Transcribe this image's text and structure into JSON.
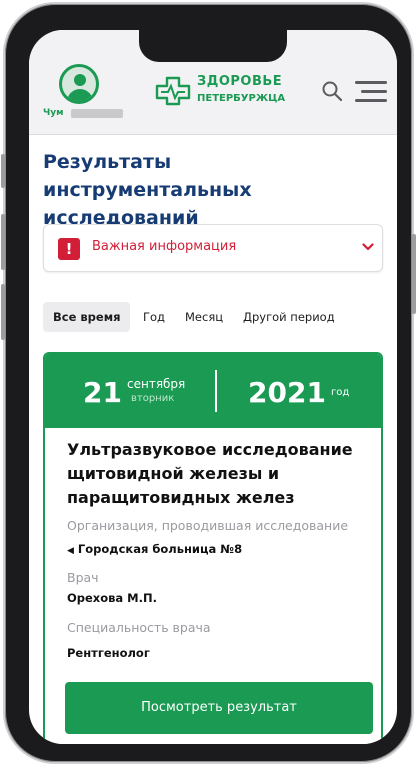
{
  "header": {
    "user_name": "Чум",
    "logo_line1": "ЗДОРОВЬЕ",
    "logo_line2": "ПЕТЕРБУРЖЦА"
  },
  "page": {
    "title": "Результаты инструментальных исследований"
  },
  "alert": {
    "label": "Важная информация",
    "mark": "!"
  },
  "period_tabs": [
    {
      "label": "Все время",
      "active": true
    },
    {
      "label": "Год",
      "active": false
    },
    {
      "label": "Месяц",
      "active": false
    },
    {
      "label": "Другой период",
      "active": false
    }
  ],
  "record": {
    "day": "21",
    "month": "сентября",
    "weekday": "вторник",
    "year": "2021",
    "year_label": "год",
    "study_title": "Ультразвуковое исследование щитовидной железы и паращитовидных желез",
    "org_label": "Организация, проводившая исследование",
    "org_value": "Городская больница №8",
    "doctor_label": "Врач",
    "doctor_value": "Орехова М.П.",
    "specialty_label": "Специальность врача",
    "specialty_value": "Рентгенолог",
    "button_label": "Посмотреть результат"
  },
  "colors": {
    "brand_green": "#1a9a53",
    "title_blue": "#173c74",
    "alert_red": "#d21e37"
  }
}
